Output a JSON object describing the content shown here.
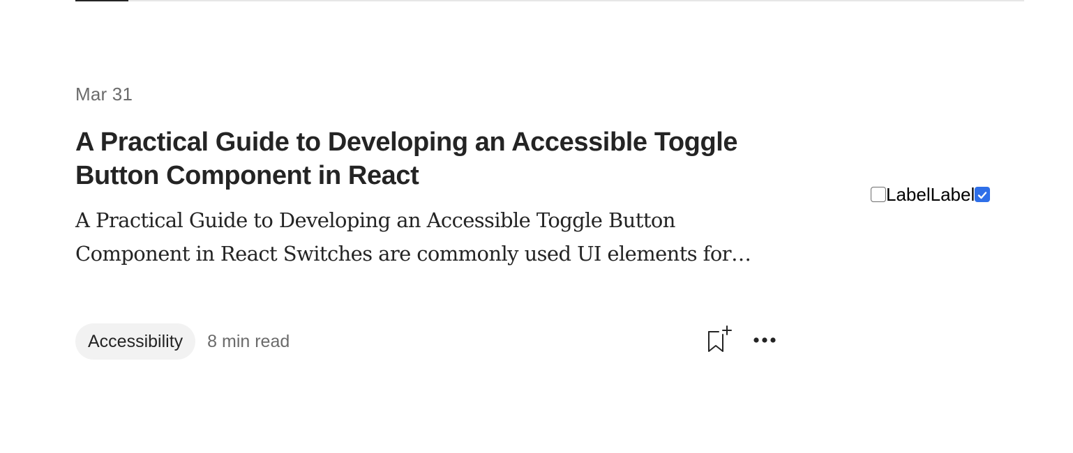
{
  "article": {
    "date": "Mar 31",
    "title": "A Practical Guide to Developing an Accessible Toggle Button Component in React",
    "excerpt": "A Practical Guide to Developing an Accessible Toggle Button Component in React Switches are commonly used UI elements for…",
    "tag": "Accessibility",
    "read_time": "8 min read"
  },
  "actions": {
    "bookmark_icon": "bookmark-add-icon",
    "more_icon": "more-horizontal-icon"
  },
  "toggle_demo": {
    "label_1": "Label",
    "checkbox_1_checked": false,
    "label_2": "Label",
    "checkbox_2_checked": true
  },
  "colors": {
    "text_primary": "#242424",
    "text_secondary": "#6b6b6b",
    "tag_background": "#f2f2f2",
    "checkbox_accent": "#2f6fe8"
  }
}
